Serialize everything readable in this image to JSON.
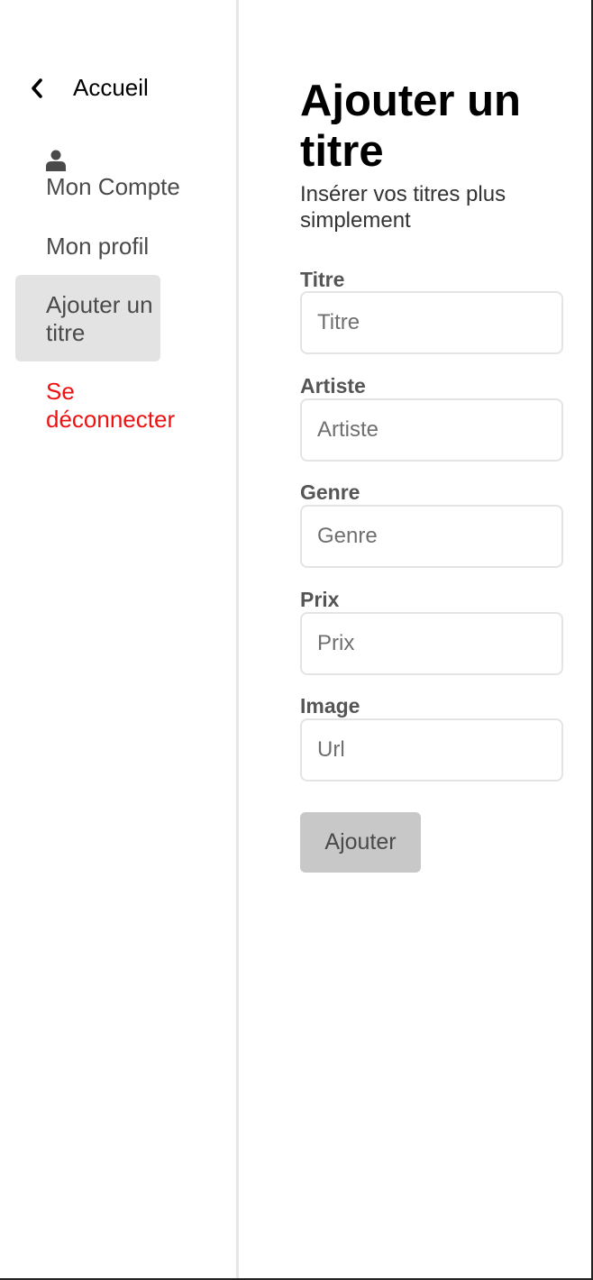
{
  "sidebar": {
    "back_label": "Accueil",
    "account_label": "Mon Compte",
    "profile_label": "Mon profil",
    "active_label": "Ajouter un titre",
    "logout_label": "Se déconnecter",
    "icons": {
      "back": "chevron-left-icon",
      "account": "user-icon"
    }
  },
  "main": {
    "title": "Ajouter un titre",
    "subtitle": "Insérer vos titres plus simplement",
    "fields": [
      {
        "label": "Titre",
        "placeholder": "Titre",
        "value": ""
      },
      {
        "label": "Artiste",
        "placeholder": "Artiste",
        "value": ""
      },
      {
        "label": "Genre",
        "placeholder": "Genre",
        "value": ""
      },
      {
        "label": "Prix",
        "placeholder": "Prix",
        "value": ""
      },
      {
        "label": "Image",
        "placeholder": "Url",
        "value": ""
      }
    ],
    "submit_label": "Ajouter"
  },
  "colors": {
    "active_bg": "#e3e3e3",
    "logout_text": "#ee1111",
    "button_bg": "#c8c8c8",
    "input_border": "#e4e4e4",
    "sidebar_divider": "#e6e6e6"
  }
}
